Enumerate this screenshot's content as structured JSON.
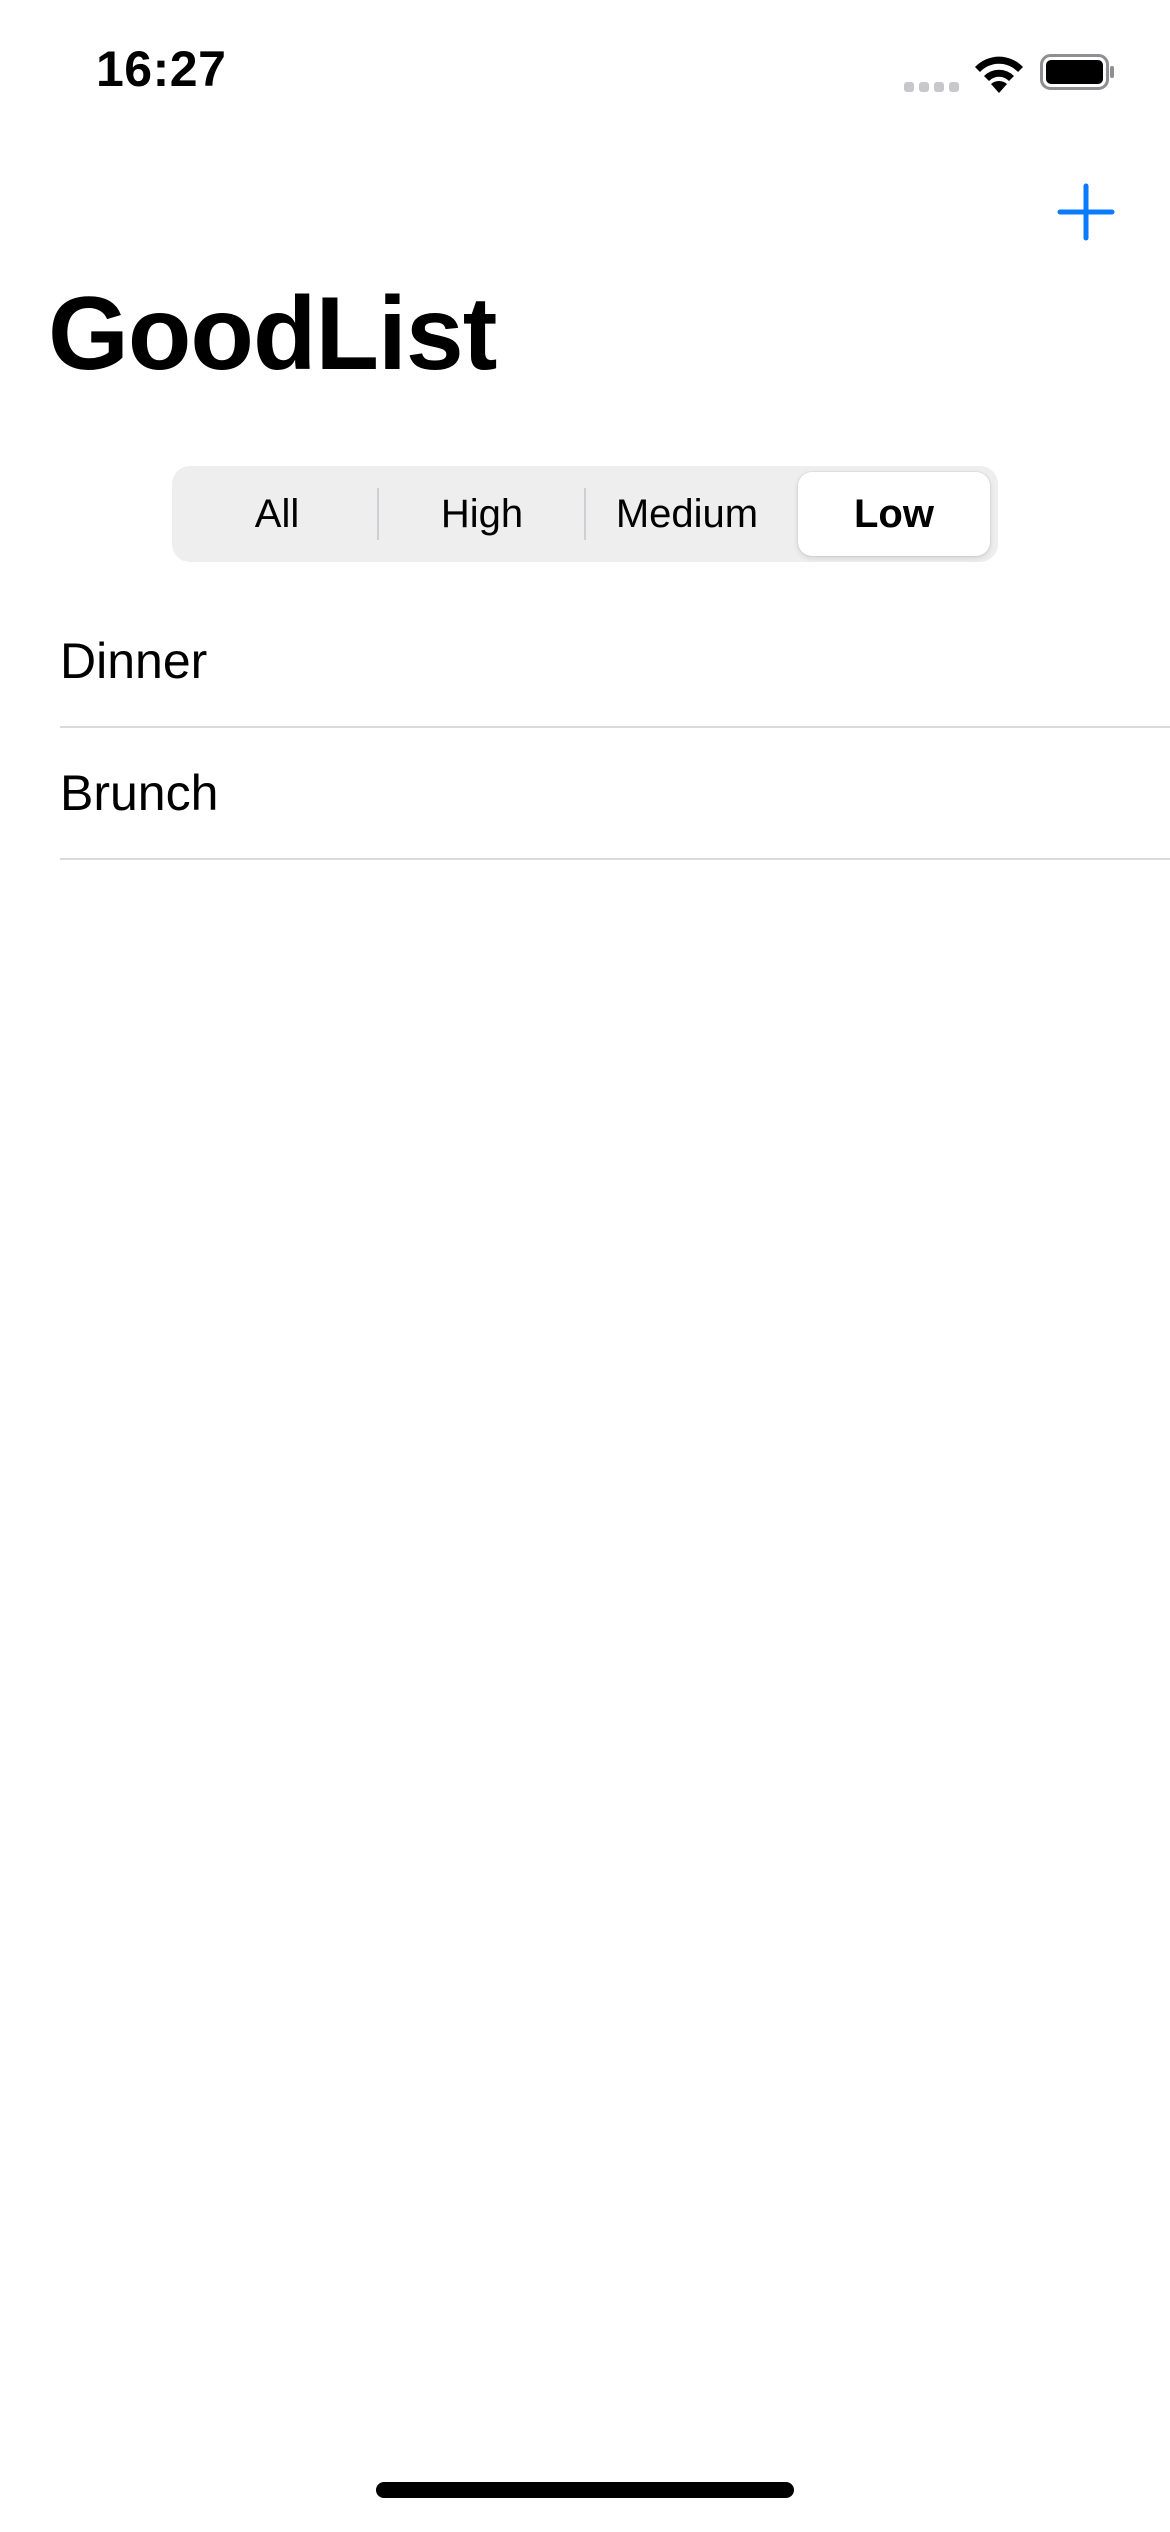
{
  "status_bar": {
    "time": "16:27",
    "icons": [
      "signal-icon",
      "wifi-icon",
      "battery-icon"
    ]
  },
  "nav": {
    "add_icon": "plus-icon",
    "accent_color": "#0a7aff"
  },
  "page": {
    "title": "GoodList"
  },
  "filter": {
    "segments": [
      {
        "label": "All"
      },
      {
        "label": "High"
      },
      {
        "label": "Medium"
      },
      {
        "label": "Low"
      }
    ],
    "selected": "Low"
  },
  "list": {
    "items": [
      {
        "label": "Dinner"
      },
      {
        "label": "Brunch"
      }
    ]
  }
}
